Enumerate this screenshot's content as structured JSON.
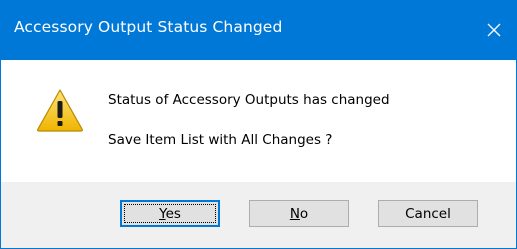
{
  "window": {
    "title": "Accessory Output Status Changed",
    "close_icon": "close-icon",
    "title_bar_color": "#0078d7"
  },
  "message": {
    "icon": "warning-icon",
    "line1": "Status of Accessory Outputs has changed",
    "line2": "Save Item List with All Changes ?"
  },
  "buttons": {
    "yes": {
      "mnemonic": "Y",
      "rest": "es",
      "default": true
    },
    "no": {
      "mnemonic": "N",
      "rest": "o"
    },
    "cancel": {
      "label": "Cancel"
    }
  }
}
